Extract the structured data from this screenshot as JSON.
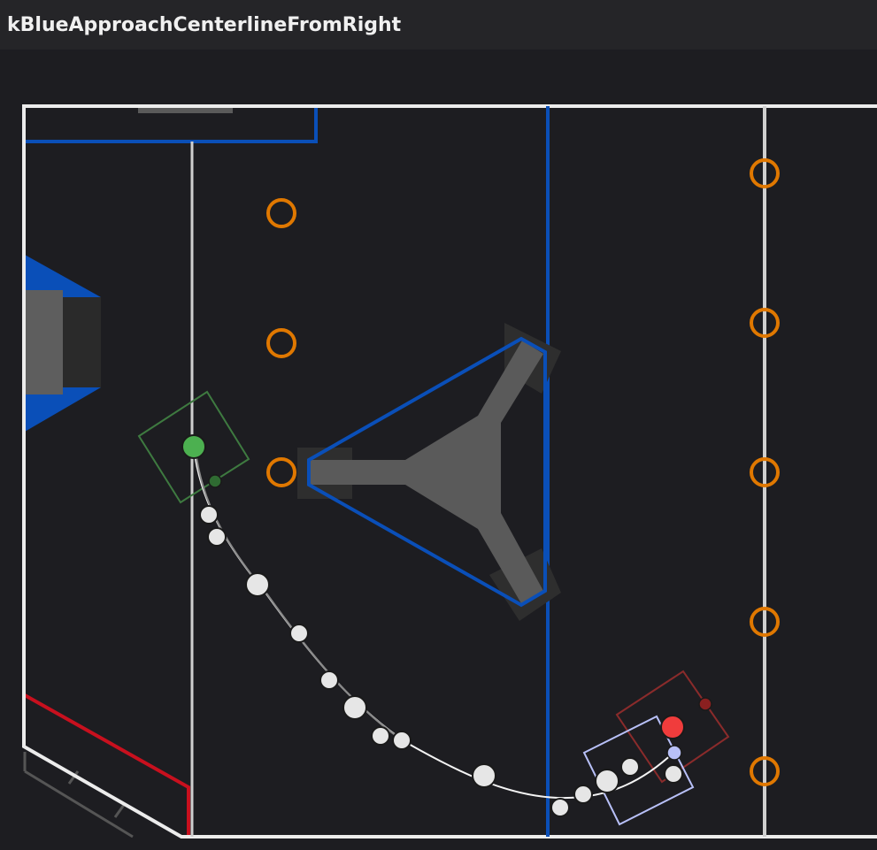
{
  "window": {
    "title": "kBlueApproachCenterlineFromRight"
  },
  "editor": {
    "view": "field-path-editor"
  },
  "colors": {
    "background": "#1d1d21",
    "field_line": "#e8e8e8",
    "blue_alliance": "#0a4fb8",
    "red_alliance": "#c8101e",
    "note_ring": "#e07800",
    "stage_gray": "#5a5a5a",
    "path_point": "#e6e6e6",
    "start_marker": "#4cb050",
    "end_marker": "#f03c3c",
    "heading_marker": "#b8c0f8"
  },
  "icons": {
    "waypoint": "circle",
    "note": "orange-ring"
  }
}
